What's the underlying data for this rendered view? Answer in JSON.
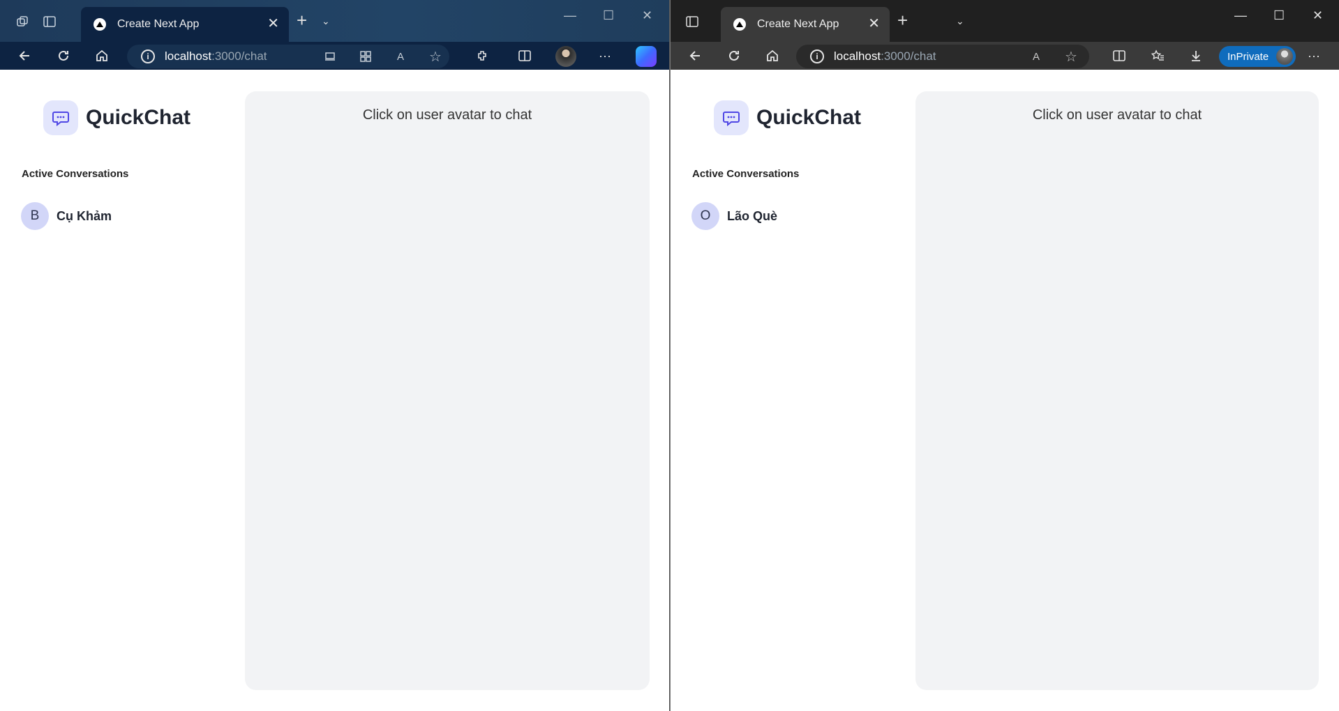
{
  "windows": [
    {
      "id": "left",
      "tab_title": "Create Next App",
      "url_host": "localhost",
      "url_path": ":3000/chat",
      "app": {
        "brand": "QuickChat",
        "section_title": "Active Conversations",
        "conversations": [
          {
            "initial": "B",
            "name": "Cụ Khảm"
          }
        ],
        "chat_placeholder": "Click on user avatar to chat"
      }
    },
    {
      "id": "right",
      "tab_title": "Create Next App",
      "url_host": "localhost",
      "url_path": ":3000/chat",
      "inprivate_label": "InPrivate",
      "app": {
        "brand": "QuickChat",
        "section_title": "Active Conversations",
        "conversations": [
          {
            "initial": "O",
            "name": "Lão Què"
          }
        ],
        "chat_placeholder": "Click on user avatar to chat"
      }
    }
  ],
  "colors": {
    "accent": "#4f46e5",
    "avatar_bg": "#d2d6f8",
    "panel_bg": "#f2f3f5",
    "inprivate": "#0f6cbd"
  }
}
